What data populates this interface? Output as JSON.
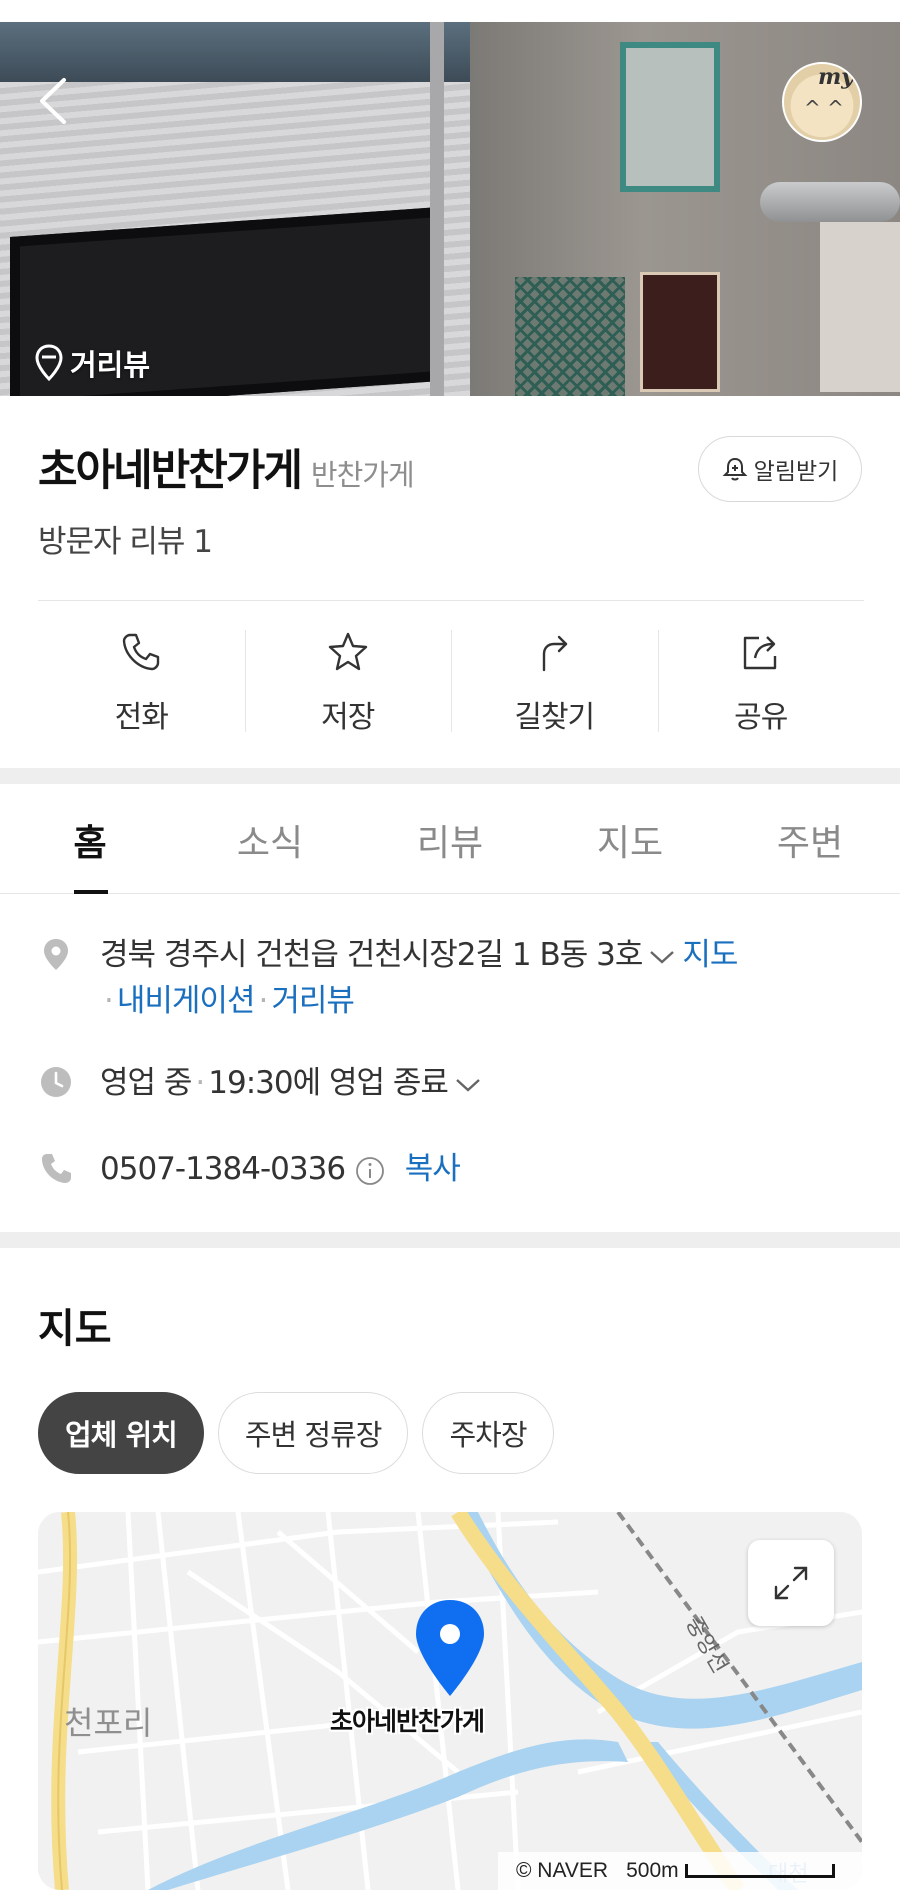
{
  "hero": {
    "streetview_label": "거리뷰",
    "avatar_badge": "my"
  },
  "place": {
    "name": "초아네반찬가게",
    "category": "반찬가게",
    "alarm_label": "알림받기",
    "review_count_text": "방문자 리뷰 1"
  },
  "actions": [
    {
      "label": "전화",
      "icon": "phone-icon"
    },
    {
      "label": "저장",
      "icon": "star-icon"
    },
    {
      "label": "길찾기",
      "icon": "directions-icon"
    },
    {
      "label": "공유",
      "icon": "share-icon"
    }
  ],
  "tabs": [
    "홈",
    "소식",
    "리뷰",
    "지도",
    "주변"
  ],
  "info": {
    "address": "경북 경주시 건천읍 건천시장2길 1 B동 3호",
    "address_map_link": "지도",
    "navigation_link": "내비게이션",
    "streetview_link": "거리뷰",
    "hours_status": "영업 중",
    "hours_detail": "19:30에 영업 종료",
    "phone": "0507-1384-0336",
    "copy_label": "복사"
  },
  "map_section": {
    "title": "지도",
    "chips": [
      "업체 위치",
      "주변 정류장",
      "주차장"
    ],
    "pin_label": "초아네반찬가게",
    "village_label": "천포리",
    "rail_label": "중앙선",
    "credit": "© NAVER",
    "scale_label": "500m",
    "bottom_label": "대천"
  },
  "colors": {
    "link_blue": "#1a6fbf",
    "pin_blue": "#0f6ff0",
    "chip_active": "#444444"
  }
}
